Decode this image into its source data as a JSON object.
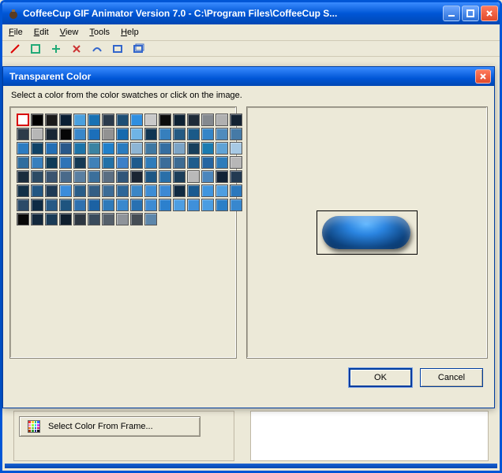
{
  "window": {
    "title": "CoffeeCup GIF Animator Version 7.0 - C:\\Program Files\\CoffeeCup S..."
  },
  "menu": {
    "file": "File",
    "edit": "Edit",
    "view": "View",
    "tools": "Tools",
    "help": "Help"
  },
  "dialog": {
    "title": "Transparent Color",
    "instruction": "Select a color from the color swatches or click on the image.",
    "ok": "OK",
    "cancel": "Cancel"
  },
  "select_color_button": "Select Color From Frame...",
  "swatch_colors": [
    "#ffffff",
    "#000000",
    "#1a1a1a",
    "#0a1e33",
    "#4aa0de",
    "#1871b3",
    "#2b3b4c",
    "#1d4f75",
    "#308fe0",
    "#c9c9c9",
    "#0d0d0d",
    "#0e2234",
    "#1f2b38",
    "#84898f",
    "#b0b0b0",
    "#142232",
    "#2d3b49",
    "#b6b6b6",
    "#182634",
    "#060606",
    "#3a87c9",
    "#1c6fba",
    "#929292",
    "#166aae",
    "#6fb4e6",
    "#0f3552",
    "#367fbd",
    "#245a82",
    "#1b5a88",
    "#3485c7",
    "#4f8bbd",
    "#467aa6",
    "#2c7cc1",
    "#0f4266",
    "#246fb5",
    "#28588a",
    "#1d74a9",
    "#3b83a2",
    "#1f80ca",
    "#2a7cbf",
    "#8db5d4",
    "#3f78a2",
    "#356ea1",
    "#7ca4c6",
    "#173f5c",
    "#1a7bb0",
    "#60a3d6",
    "#a7c9e4",
    "#2f6d9e",
    "#377fbd",
    "#0f3b57",
    "#2e74b7",
    "#143954",
    "#3f81b8",
    "#2271a7",
    "#3c80c8",
    "#1e5a8c",
    "#2f7cba",
    "#3b6d9a",
    "#3c6b93",
    "#1e5c8c",
    "#2666a1",
    "#2e7cba",
    "#b7b7b7",
    "#1a2c3d",
    "#2c4a64",
    "#3a5470",
    "#4a6a8a",
    "#5a7fa1",
    "#3b6f9b",
    "#5a6e82",
    "#305679",
    "#1a2432",
    "#1d5684",
    "#2a6fa8",
    "#1b3d59",
    "#b9b9b9",
    "#4b86bc",
    "#112236",
    "#233a52",
    "#123047",
    "#225682",
    "#1e3a55",
    "#3b8cdb",
    "#295d88",
    "#345e84",
    "#3c6c96",
    "#2e6798",
    "#3b86c6",
    "#3e8dd4",
    "#3c89d4",
    "#102a41",
    "#1a5a90",
    "#3f95de",
    "#4e9ee0",
    "#2b78bd",
    "#2b4a68",
    "#0e2b45",
    "#265985",
    "#1e547f",
    "#2f71af",
    "#1c62a3",
    "#2f7ab9",
    "#3a88cd",
    "#2870b1",
    "#3e8bd3",
    "#2c80cd",
    "#4d9ee2",
    "#3f90da",
    "#4a9de2",
    "#2b7fc7",
    "#3887ce",
    "#080808",
    "#13283c",
    "#1a3b57",
    "#0f1e2d",
    "#2d3742",
    "#3a4b5c",
    "#55606b",
    "#8f949a",
    "#454d55",
    "#5d87ab"
  ]
}
